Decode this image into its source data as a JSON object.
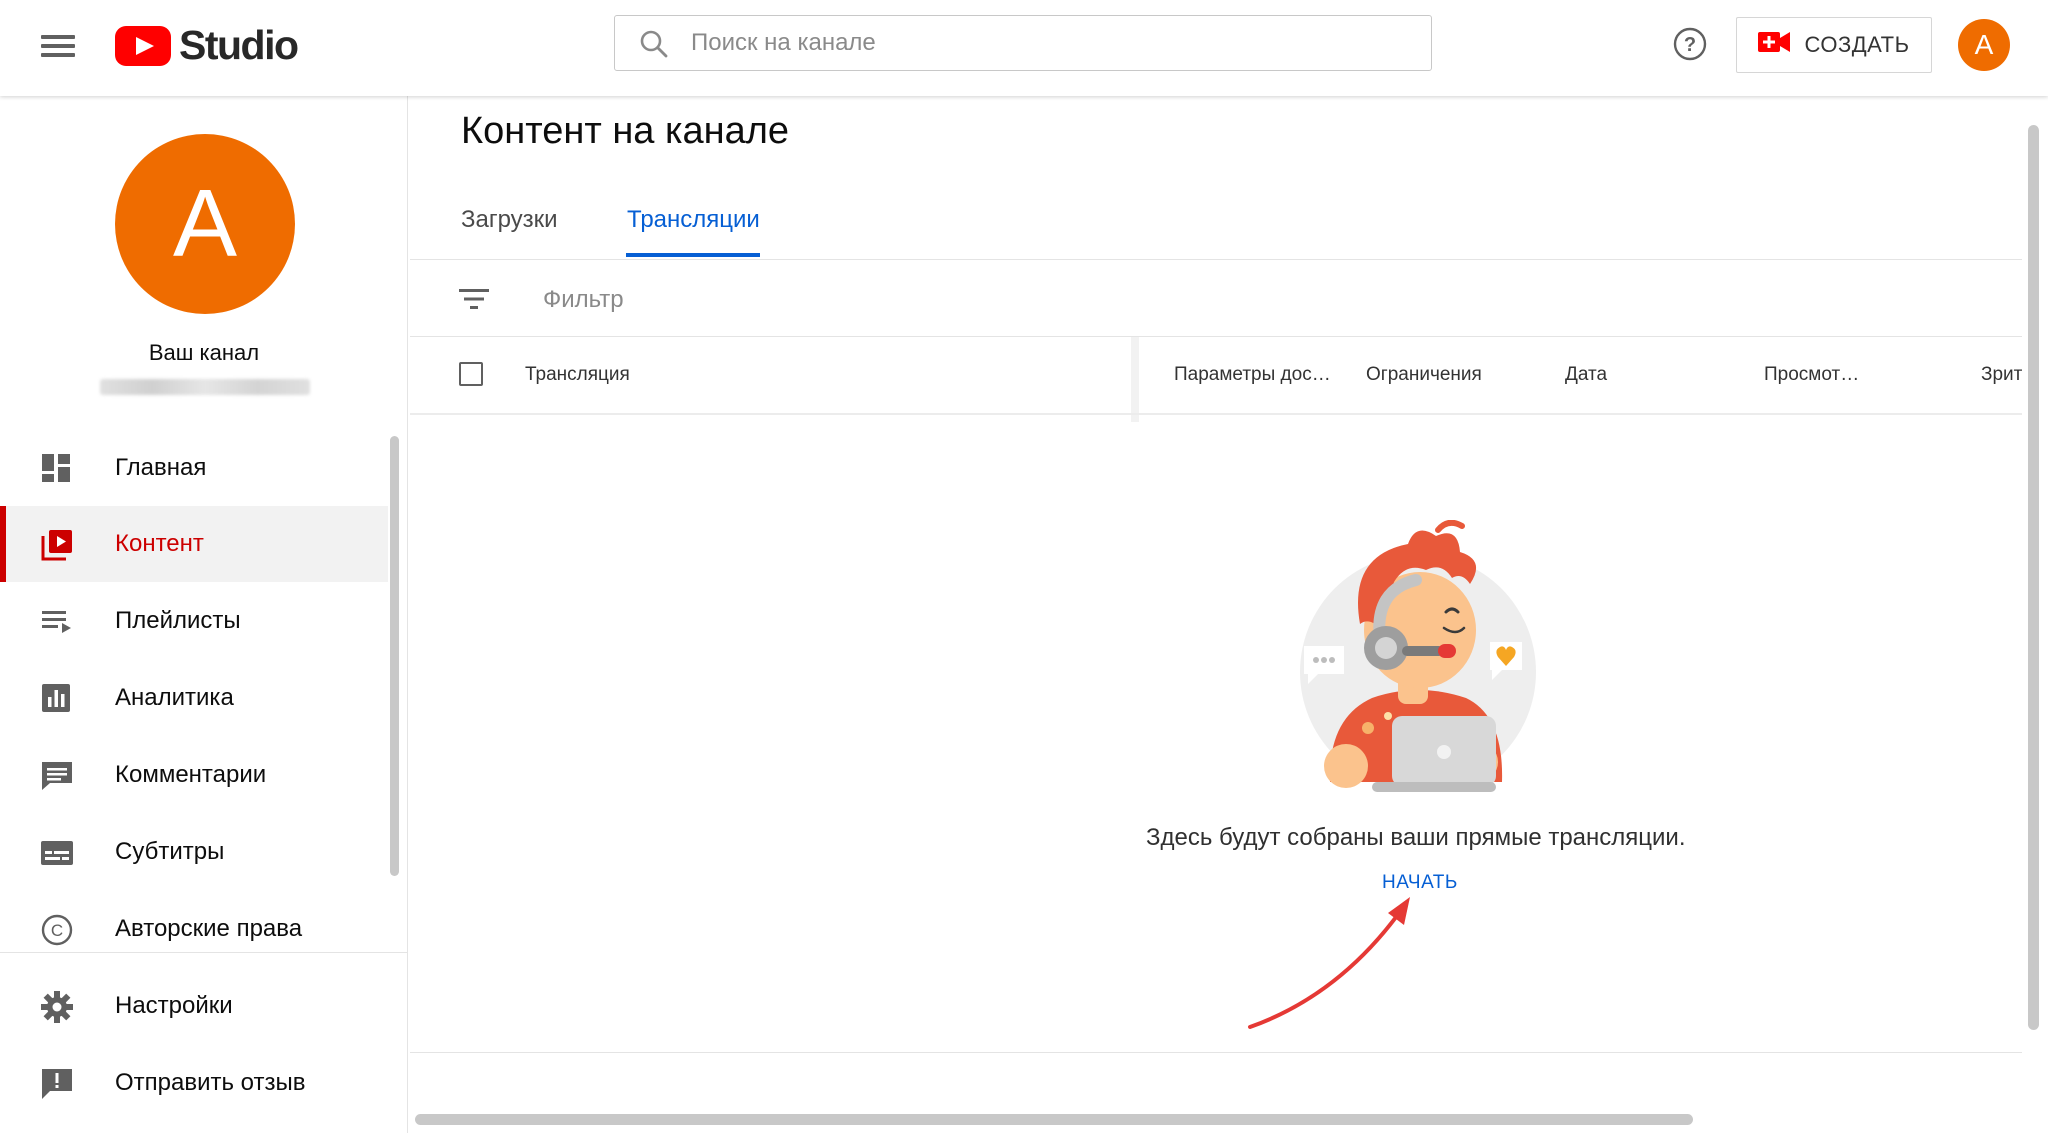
{
  "app": {
    "logo_text": "Studio"
  },
  "search": {
    "placeholder": "Поиск на канале"
  },
  "header": {
    "create_label": "СОЗДАТЬ",
    "avatar_letter": "A"
  },
  "sidebar": {
    "channel_avatar_letter": "A",
    "channel_title": "Ваш канал",
    "items": [
      {
        "label": "Главная",
        "icon": "dashboard-icon"
      },
      {
        "label": "Контент",
        "icon": "content-icon",
        "active": true
      },
      {
        "label": "Плейлисты",
        "icon": "playlist-icon"
      },
      {
        "label": "Аналитика",
        "icon": "analytics-icon"
      },
      {
        "label": "Комментарии",
        "icon": "comments-icon"
      },
      {
        "label": "Субтитры",
        "icon": "subtitles-icon"
      },
      {
        "label": "Авторские права",
        "icon": "copyright-icon"
      },
      {
        "label": "Настройки",
        "icon": "gear-icon"
      },
      {
        "label": "Отправить отзыв",
        "icon": "feedback-icon"
      }
    ]
  },
  "main": {
    "title": "Контент на канале",
    "tabs": [
      {
        "label": "Загрузки",
        "active": false
      },
      {
        "label": "Трансляции",
        "active": true
      }
    ],
    "filter_label": "Фильтр",
    "columns": [
      "Трансляция",
      "Параметры дос…",
      "Ограничения",
      "Дата",
      "Просмот…",
      "Зрит"
    ],
    "empty_state": {
      "message": "Здесь будут собраны ваши прямые трансляции.",
      "action_label": "НАЧАТЬ"
    }
  },
  "colors": {
    "brand_red": "#ff0000",
    "active_red": "#cc0000",
    "link_blue": "#065fd4",
    "avatar_orange": "#ef6c00"
  }
}
